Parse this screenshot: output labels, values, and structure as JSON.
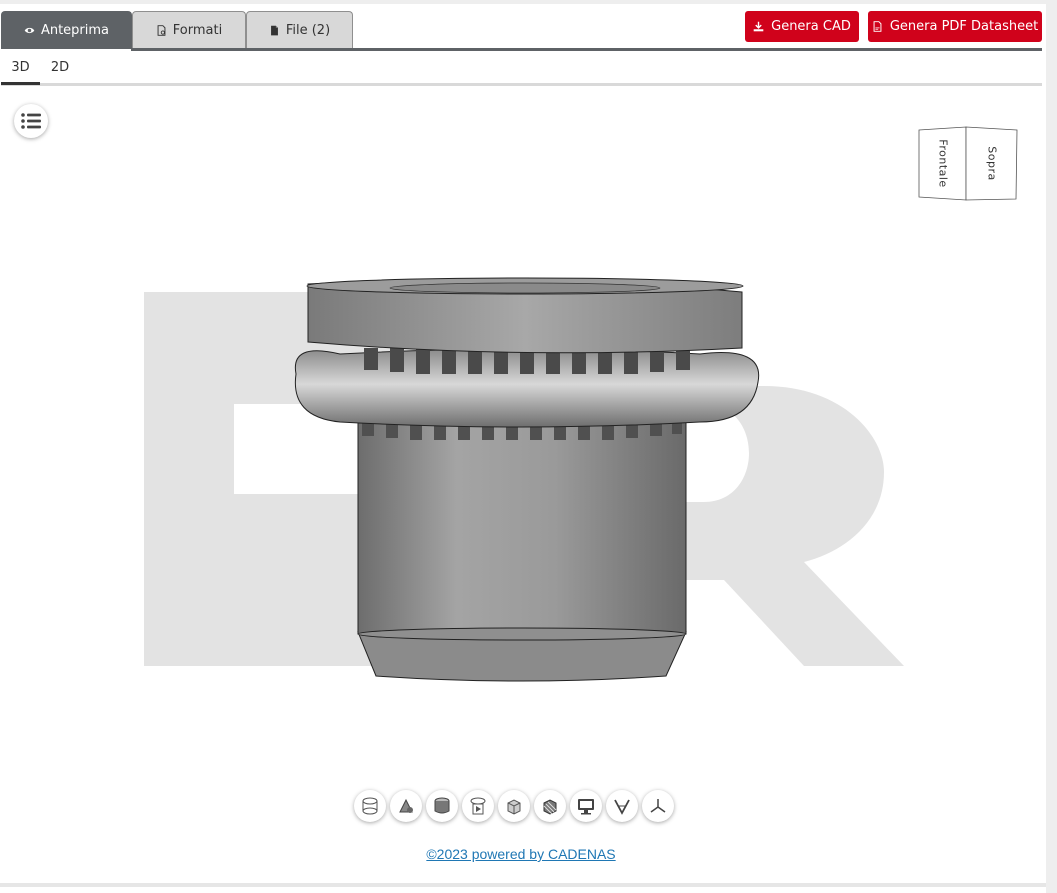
{
  "tabs": [
    {
      "label": "Anteprima",
      "icon": "eye-icon",
      "active": true
    },
    {
      "label": "Formati",
      "icon": "file-settings-icon",
      "active": false
    },
    {
      "label": "File (2)",
      "icon": "file-icon",
      "active": false
    }
  ],
  "actions": {
    "cad_label": "Genera CAD",
    "pdf_label": "Genera PDF Datasheet"
  },
  "view_tabs": [
    {
      "label": "3D",
      "active": true
    },
    {
      "label": "2D",
      "active": false
    }
  ],
  "viewcube": {
    "front_label": "Frontale",
    "top_label": "Sopra"
  },
  "toolbar_icons": [
    "cylinder-wireframe-icon",
    "explode-view-icon",
    "solid-shaded-icon",
    "animate-rotate-icon",
    "solid-cube-icon",
    "section-hatch-icon",
    "monitor-icon",
    "measure-icon",
    "axes-icon"
  ],
  "footer": {
    "link_text": "©2023 powered by CADENAS"
  },
  "colors": {
    "primary_red": "#d0021b",
    "active_tab": "#5e6266",
    "link": "#1f77b4"
  }
}
